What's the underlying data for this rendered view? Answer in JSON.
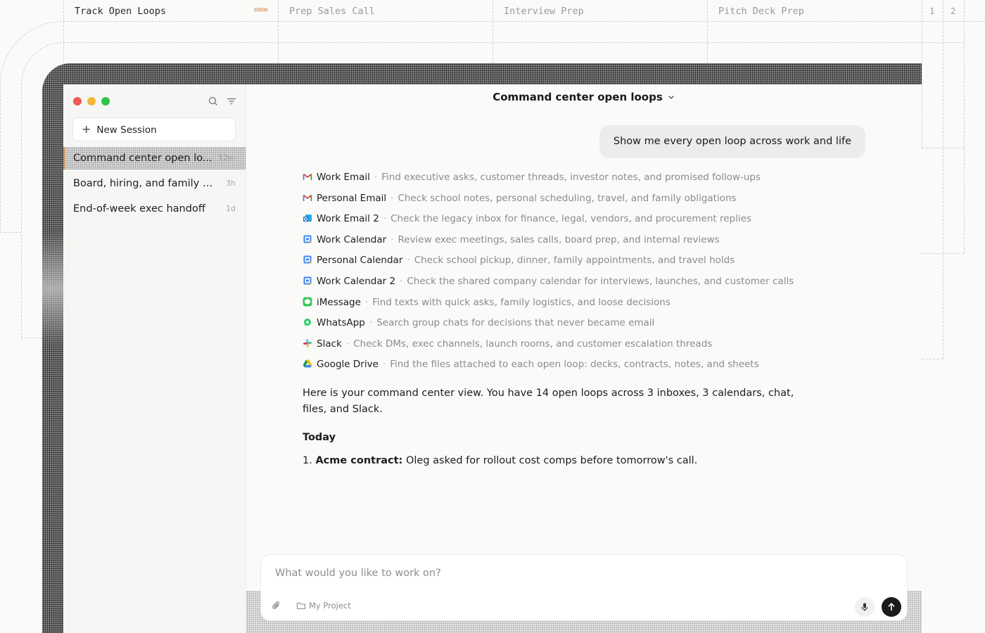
{
  "tabs": [
    {
      "label": "Track Open Loops",
      "active": true
    },
    {
      "label": "Prep Sales Call",
      "active": false
    },
    {
      "label": "Interview Prep",
      "active": false
    },
    {
      "label": "Pitch Deck Prep",
      "active": false
    }
  ],
  "tab_arrows": "»»»",
  "pages": [
    "1",
    "2"
  ],
  "sidebar": {
    "new_session_label": "New Session",
    "sessions": [
      {
        "label": "Command center open lo...",
        "time": "12m",
        "active": true
      },
      {
        "label": "Board, hiring, and family s...",
        "time": "3h",
        "active": false
      },
      {
        "label": "End-of-week exec handoff",
        "time": "1d",
        "active": false
      }
    ]
  },
  "chat": {
    "title": "Command center open loops",
    "user_message": "Show me every open loop across work and life",
    "sources": [
      {
        "icon": "gmail-icon",
        "name": "Work Email",
        "desc": "Find executive asks, customer threads, investor notes, and promised follow-ups"
      },
      {
        "icon": "gmail-icon",
        "name": "Personal Email",
        "desc": "Check school notes, personal scheduling, travel, and family obligations"
      },
      {
        "icon": "outlook-icon",
        "name": "Work Email 2",
        "desc": "Check the legacy inbox for finance, legal, vendors, and procurement replies"
      },
      {
        "icon": "calendar-icon",
        "name": "Work Calendar",
        "desc": "Review exec meetings, sales calls, board prep, and internal reviews"
      },
      {
        "icon": "calendar-icon",
        "name": "Personal Calendar",
        "desc": "Check school pickup, dinner, family appointments, and travel holds"
      },
      {
        "icon": "calendar-icon",
        "name": "Work Calendar 2",
        "desc": "Check the shared company calendar for interviews, launches, and customer calls"
      },
      {
        "icon": "imessage-icon",
        "name": "iMessage",
        "desc": "Find texts with quick asks, family logistics, and loose decisions"
      },
      {
        "icon": "whatsapp-icon",
        "name": "WhatsApp",
        "desc": "Search group chats for decisions that never became email"
      },
      {
        "icon": "slack-icon",
        "name": "Slack",
        "desc": "Check DMs, exec channels, launch rooms, and customer escalation threads"
      },
      {
        "icon": "google-drive-icon",
        "name": "Google Drive",
        "desc": "Find the files attached to each open loop: decks, contracts, notes, and sheets"
      }
    ],
    "answer": "Here is your command center view. You have 14 open loops across 3 inboxes, 3 calendars, chat, files, and Slack.",
    "today_heading": "Today",
    "item_1_number": "1.",
    "item_1_title": "Acme contract:",
    "item_1_text": " Oleg asked for rollout cost comps before tomorrow's call."
  },
  "composer": {
    "placeholder": "What would you like to work on?",
    "project_label": "My Project"
  },
  "colors": {
    "accent": "#d08a4a",
    "traffic_red": "#ef5a52",
    "traffic_yellow": "#f4b73a",
    "traffic_green": "#2fc445",
    "send_button": "#1b1b1b"
  }
}
